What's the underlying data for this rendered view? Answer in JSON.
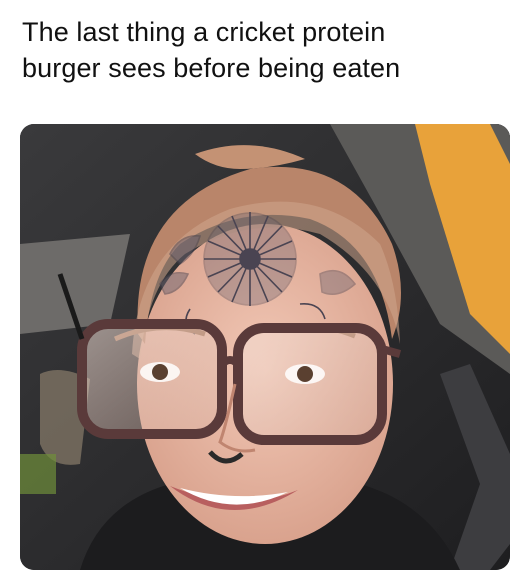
{
  "caption": {
    "line1": "The last thing a cricket protein",
    "line2": "burger sees before being eaten"
  },
  "photo": {
    "subject": "selfie-photo"
  },
  "colors": {
    "background": "#ffffff",
    "caption_text": "#111111",
    "car_interior": "#2a2a2c",
    "window_yellow": "#e8a23a",
    "skin": "#e9b9a6",
    "hair": "#b9856a",
    "tattoo": "#4a4452",
    "glasses_frame": "#5a3a3a",
    "hoodie": "#1c1c1e"
  }
}
